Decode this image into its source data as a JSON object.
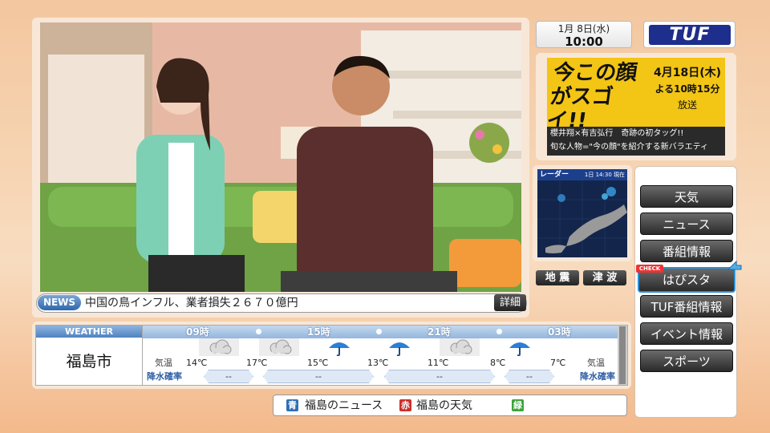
{
  "header": {
    "date": "1月  8日(水)",
    "time": "10:00",
    "logo": "TUF"
  },
  "news": {
    "badge": "NEWS",
    "headline": "中国の鳥インフル、業者損失２６７０億円",
    "detail_label": "詳細"
  },
  "promo": {
    "title": "今この顔がスゴイ!!",
    "date": "4月18日(木)",
    "time": "よる10時15分",
    "onair": "放送",
    "desc_line1": "櫻井翔×有吉弘行　奇跡の初タッグ!!",
    "desc_line2": "旬な人物=\"今の顔\"を紹介する新バラエティ"
  },
  "radar": {
    "title": "レーダー",
    "time": "1日 14:30 現在"
  },
  "disaster": {
    "earthquake": "地 震",
    "tsunami": "津 波"
  },
  "menu": {
    "check_badge": "CHECK",
    "items": [
      {
        "label": "天気"
      },
      {
        "label": "ニュース"
      },
      {
        "label": "番組情報"
      },
      {
        "label": "はぴスタ"
      },
      {
        "label": "TUF番組情報"
      },
      {
        "label": "イベント情報"
      },
      {
        "label": "スポーツ"
      }
    ]
  },
  "weather": {
    "label": "WEATHER",
    "city": "福島市",
    "hours": [
      "09時",
      "15時",
      "21時",
      "03時"
    ],
    "icons": [
      "cloudy-icon",
      "cloudy-icon",
      "umbrella-icon",
      "umbrella-icon",
      "cloudy-icon",
      "umbrella-icon"
    ],
    "temp_label": "気温",
    "temps": [
      "14℃",
      "17℃",
      "15℃",
      "13℃",
      "11℃",
      "8℃",
      "7℃"
    ],
    "rain_label": "降水確率",
    "rain": [
      "--",
      "--",
      "--",
      "--"
    ]
  },
  "legend": {
    "blue_key": "青",
    "blue_label": "福島のニュース",
    "red_key": "赤",
    "red_label": "福島の天気",
    "green_key": "緑",
    "colors": {
      "blue": "#2f6fb5",
      "red": "#c9302c",
      "green": "#3aa33a"
    }
  }
}
